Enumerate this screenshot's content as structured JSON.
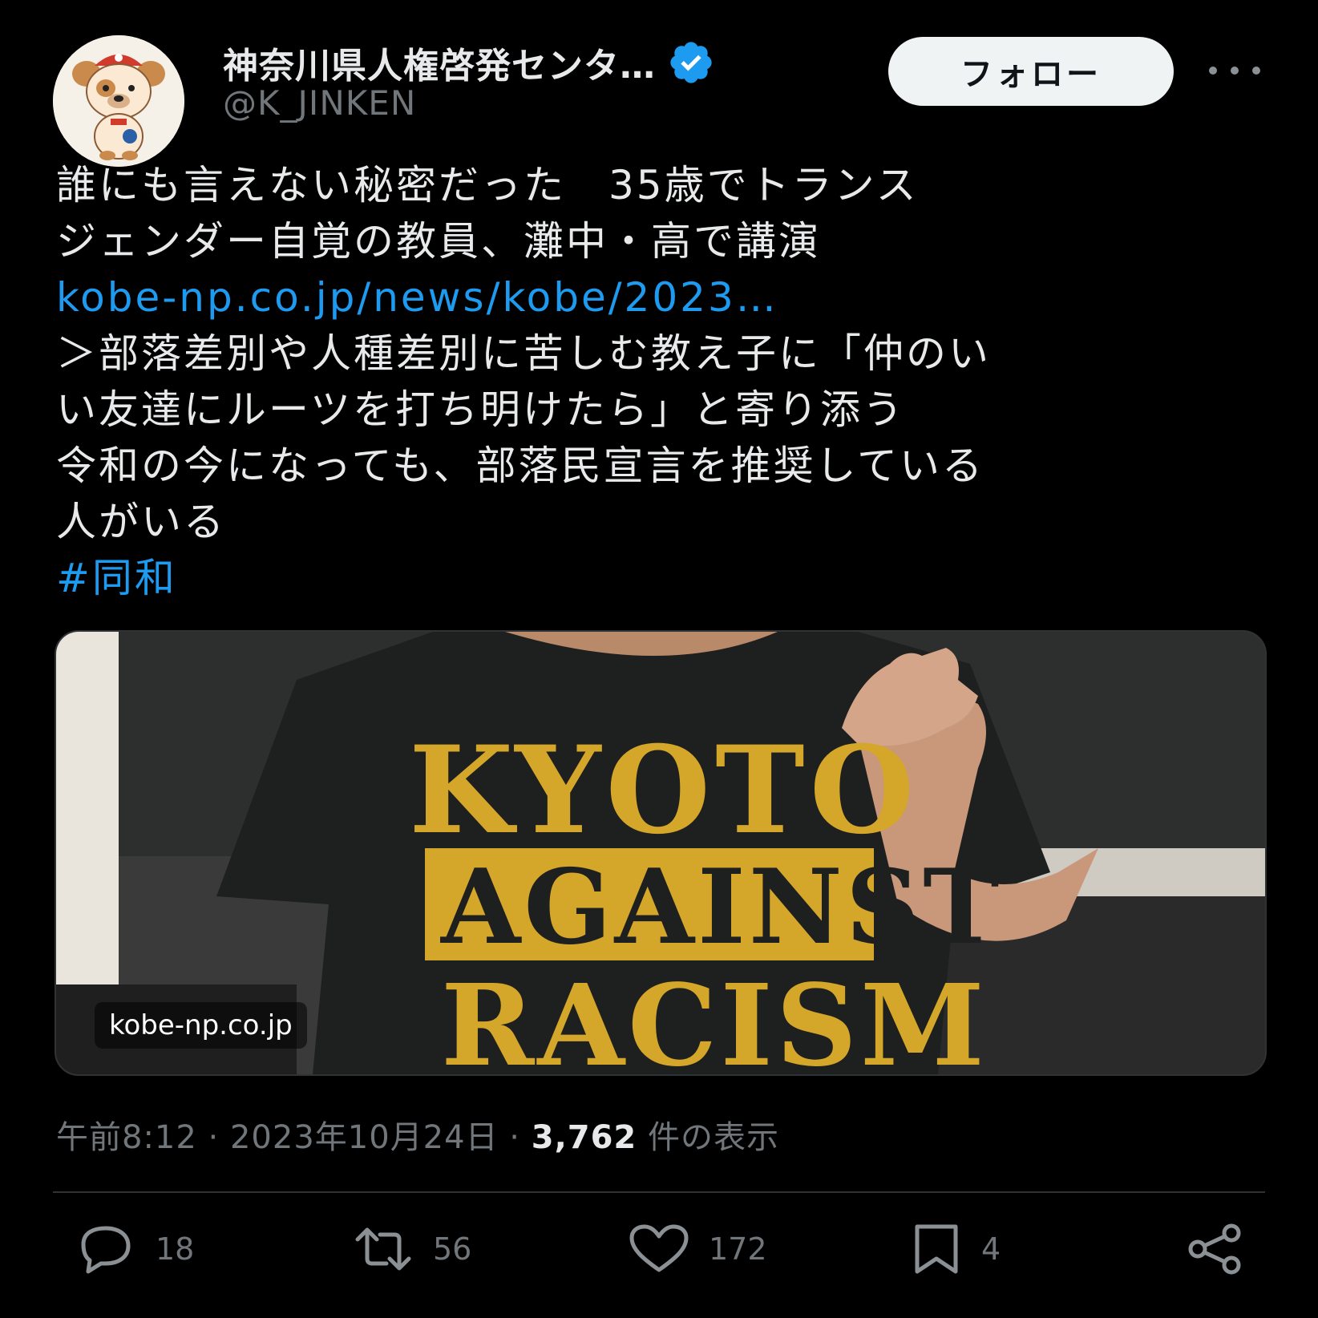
{
  "account": {
    "display_name": "神奈川県人権啓発センタ…",
    "handle": "@K_JINKEN",
    "follow_label": "フォロー",
    "avatar_icon": "bulldog-mascot-avatar",
    "verified_icon": "verified-badge-icon",
    "more_icon": "more-options-icon"
  },
  "tweet": {
    "lines": [
      "誰にも言えない秘密だった　35歳でトランス",
      "ジェンダー自覚の教員、灘中・高で講演"
    ],
    "link": "kobe-np.co.jp/news/kobe/2023…",
    "quote_lines": [
      "＞部落差別や人種差別に苦しむ教え子に「仲のい",
      "い友達にルーツを打ち明けたら」と寄り添う",
      "令和の今になっても、部落民宣言を推奨している",
      "人がいる"
    ],
    "hashtag": "#同和"
  },
  "media": {
    "domain": "kobe-np.co.jp",
    "shirt_text": [
      "KYOTO",
      "AGAINST",
      "RACISM"
    ]
  },
  "meta": {
    "time": "午前8:12",
    "separator1": "·",
    "date": "2023年10月24日",
    "separator2": "·",
    "views": "3,762",
    "views_label": "件の表示"
  },
  "actions": {
    "replies": "18",
    "retweets": "56",
    "likes": "172",
    "bookmarks": "4",
    "reply_icon": "reply-icon",
    "retweet_icon": "retweet-icon",
    "like_icon": "heart-icon",
    "bookmark_icon": "bookmark-icon",
    "share_icon": "share-icon"
  },
  "colors": {
    "background": "#000000",
    "text": "#e7e9ea",
    "secondary": "#71767b",
    "link": "#1d9bf0",
    "verified": "#1d9bf0",
    "shirt_print": "#d4a62a"
  }
}
